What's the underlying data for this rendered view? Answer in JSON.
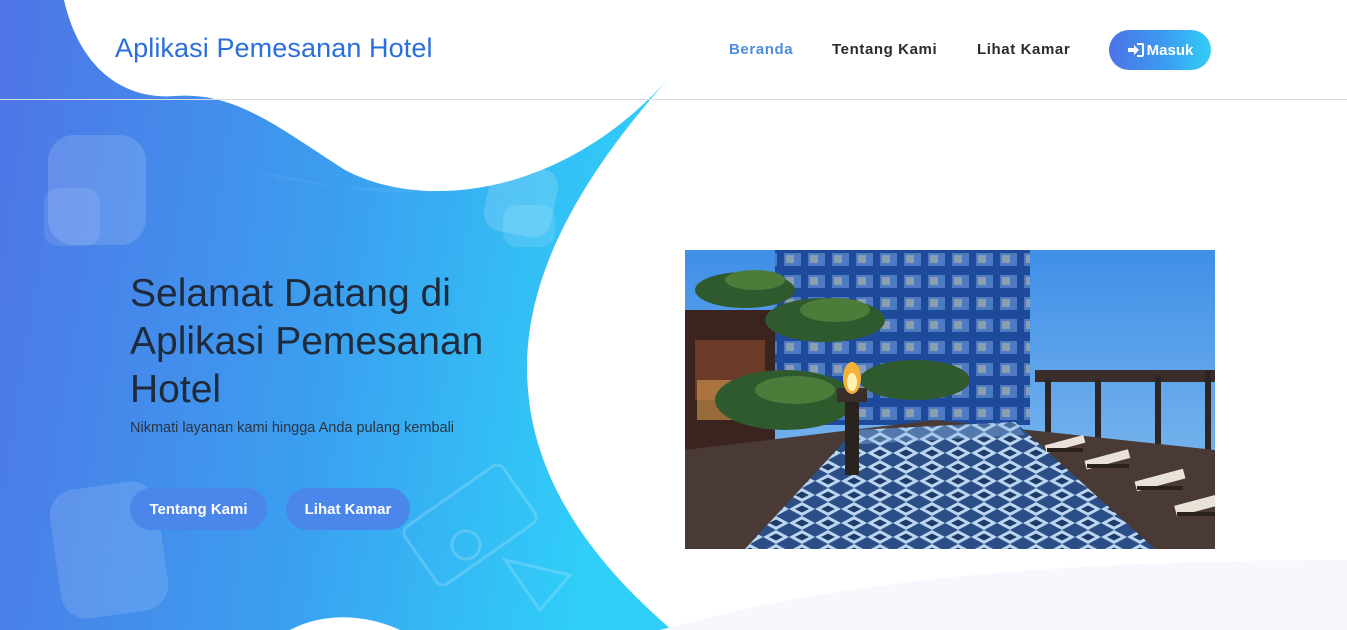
{
  "header": {
    "brand": "Aplikasi Pemesanan Hotel",
    "nav": [
      {
        "label": "Beranda",
        "active": true
      },
      {
        "label": "Tentang Kami",
        "active": false
      },
      {
        "label": "Lihat Kamar",
        "active": false
      }
    ],
    "login": {
      "label": "Masuk",
      "icon": "sign-in-icon"
    }
  },
  "hero": {
    "title": "Selamat Datang di Aplikasi Pemesanan Hotel",
    "subtitle": "Nikmati layanan kami hingga Anda pulang kembali",
    "buttons": [
      {
        "label": "Tentang Kami"
      },
      {
        "label": "Lihat Kamar"
      }
    ],
    "image": {
      "subject": "hotel-rooftop-pool-photo"
    }
  },
  "colors": {
    "brand": "#2a6fdb",
    "nav_active": "#4d8de0",
    "gradient_start": "#4e73e6",
    "gradient_end": "#33cdf6",
    "button": "#4b86ea"
  }
}
